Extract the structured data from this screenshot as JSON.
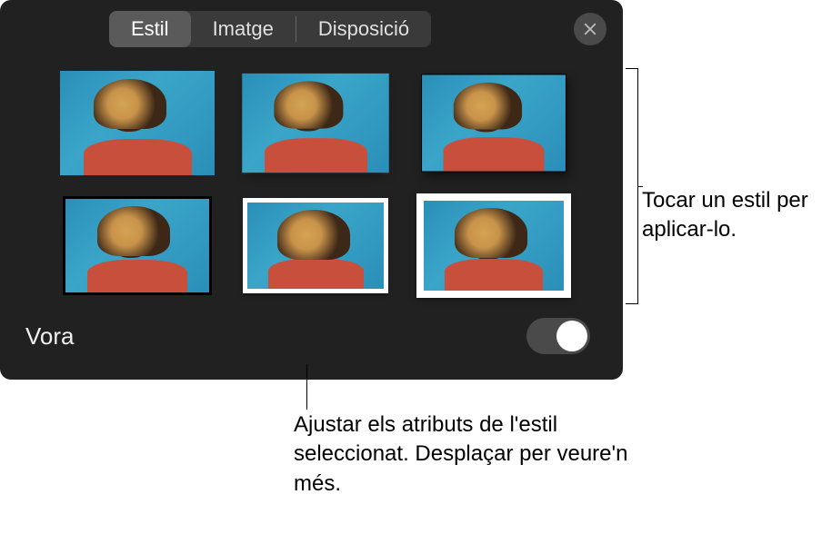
{
  "tabs": {
    "style": "Estil",
    "image": "Imatge",
    "layout": "Disposició"
  },
  "footer": {
    "border_label": "Vora"
  },
  "callouts": {
    "tap_style": "Tocar un estil per aplicar-lo.",
    "adjust_attrs": "Ajustar els atributs de l'estil seleccionat. Desplaçar per veure'n més."
  }
}
